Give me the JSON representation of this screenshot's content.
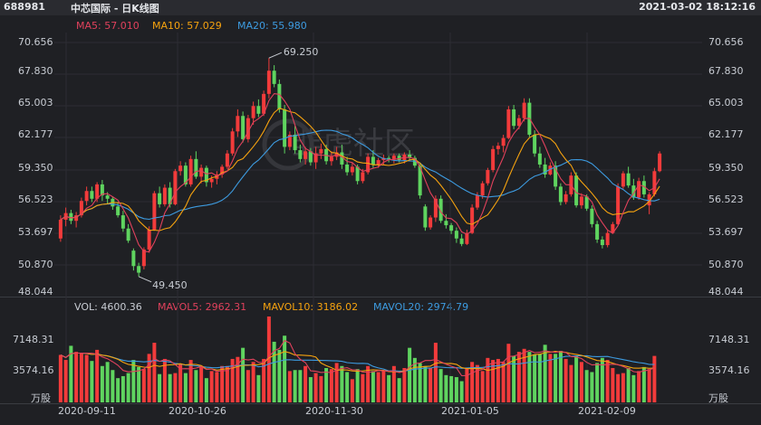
{
  "header": {
    "code": "688981",
    "title": "中芯国际 - 日K线图",
    "datetime": "2021-03-02 18:12:16"
  },
  "price_legend": [
    {
      "label": "MA5: 57.010",
      "color": "#e0415c"
    },
    {
      "label": "MA10: 57.029",
      "color": "#f5a20f"
    },
    {
      "label": "MA20: 55.980",
      "color": "#3d9be0"
    }
  ],
  "volume_legend": [
    {
      "label": "VOL: 4600.36",
      "color": "#c8ccd3"
    },
    {
      "label": "MAVOL5: 2962.31",
      "color": "#e0415c"
    },
    {
      "label": "MAVOL10: 3186.02",
      "color": "#f5a20f"
    },
    {
      "label": "MAVOL20: 2974.79",
      "color": "#3d9be0"
    }
  ],
  "price_axis": [
    "70.656",
    "67.830",
    "65.003",
    "62.177",
    "59.350",
    "56.523",
    "53.697",
    "50.870",
    "48.044"
  ],
  "volume_axis": [
    "7148.31",
    "3574.16",
    "万股"
  ],
  "date_axis": [
    "2020-09-11",
    "2020-10-26",
    "2020-11-30",
    "2021-01-05",
    "2021-02-09"
  ],
  "annotations": {
    "high": "69.250",
    "low": "49.450"
  },
  "watermark": "韭虎社区",
  "colors": {
    "up": "#f23b3b",
    "down": "#5fd45f"
  },
  "chart_data": {
    "type": "candlestick",
    "title": "中芯国际 - 日K线图",
    "ylim": [
      48.044,
      70.656
    ],
    "volume_ylim": [
      0,
      8500
    ],
    "ohlc": [
      [
        52.9,
        55.0,
        52.6,
        54.6
      ],
      [
        54.6,
        55.7,
        54.0,
        55.2
      ],
      [
        55.2,
        55.5,
        54.2,
        54.5
      ],
      [
        54.5,
        55.3,
        53.9,
        55.0
      ],
      [
        55.0,
        56.6,
        54.8,
        56.3
      ],
      [
        56.3,
        57.6,
        55.9,
        57.2
      ],
      [
        57.2,
        57.6,
        56.2,
        56.5
      ],
      [
        56.5,
        58.0,
        56.2,
        57.8
      ],
      [
        57.8,
        58.2,
        56.3,
        56.8
      ],
      [
        56.8,
        57.1,
        56.0,
        56.5
      ],
      [
        56.5,
        56.7,
        55.5,
        55.8
      ],
      [
        55.8,
        56.2,
        54.8,
        55.0
      ],
      [
        55.0,
        55.4,
        53.5,
        53.8
      ],
      [
        53.8,
        54.2,
        52.5,
        52.7
      ],
      [
        51.8,
        52.0,
        50.0,
        50.4
      ],
      [
        50.4,
        50.7,
        49.45,
        49.8
      ],
      [
        50.4,
        52.1,
        50.1,
        51.9
      ],
      [
        51.9,
        54.0,
        51.6,
        53.7
      ],
      [
        53.7,
        57.2,
        53.6,
        57.0
      ],
      [
        57.0,
        57.6,
        55.7,
        56.0
      ],
      [
        56.0,
        57.8,
        55.8,
        57.5
      ],
      [
        57.5,
        58.0,
        55.7,
        56.0
      ],
      [
        56.0,
        59.2,
        55.9,
        59.0
      ],
      [
        59.0,
        59.9,
        58.6,
        59.5
      ],
      [
        59.5,
        59.8,
        57.6,
        57.8
      ],
      [
        57.8,
        60.4,
        57.6,
        60.1
      ],
      [
        60.1,
        60.8,
        58.3,
        58.5
      ],
      [
        58.5,
        59.6,
        57.9,
        59.3
      ],
      [
        59.3,
        59.5,
        57.6,
        58.0
      ],
      [
        58.0,
        58.6,
        57.5,
        58.3
      ],
      [
        58.3,
        59.0,
        57.8,
        58.7
      ],
      [
        58.7,
        59.6,
        58.4,
        59.4
      ],
      [
        59.4,
        60.9,
        59.2,
        60.6
      ],
      [
        60.6,
        62.9,
        60.4,
        62.6
      ],
      [
        62.6,
        64.6,
        62.1,
        64.0
      ],
      [
        64.0,
        64.4,
        61.6,
        61.9
      ],
      [
        61.9,
        64.1,
        61.6,
        63.8
      ],
      [
        63.8,
        65.3,
        63.2,
        64.9
      ],
      [
        64.9,
        65.5,
        63.9,
        64.2
      ],
      [
        64.2,
        66.3,
        64.0,
        66.0
      ],
      [
        66.0,
        69.25,
        65.6,
        68.1
      ],
      [
        68.1,
        68.6,
        66.6,
        66.9
      ],
      [
        66.9,
        67.3,
        64.3,
        64.6
      ],
      [
        64.6,
        65.0,
        60.6,
        61.2
      ],
      [
        61.2,
        62.6,
        60.9,
        62.3
      ],
      [
        62.3,
        63.1,
        60.6,
        60.9
      ],
      [
        60.9,
        61.4,
        59.8,
        60.1
      ],
      [
        60.1,
        61.2,
        59.6,
        60.8
      ],
      [
        60.8,
        61.1,
        59.5,
        59.8
      ],
      [
        59.8,
        61.2,
        59.2,
        60.6
      ],
      [
        60.6,
        61.5,
        60.1,
        61.0
      ],
      [
        61.0,
        61.4,
        59.6,
        59.9
      ],
      [
        59.9,
        60.8,
        59.5,
        60.3
      ],
      [
        60.3,
        61.2,
        60.0,
        60.7
      ],
      [
        60.7,
        61.4,
        59.2,
        59.6
      ],
      [
        59.6,
        60.3,
        58.6,
        58.9
      ],
      [
        58.9,
        59.8,
        58.6,
        59.4
      ],
      [
        59.4,
        59.6,
        57.8,
        58.1
      ],
      [
        58.1,
        59.2,
        57.9,
        58.9
      ],
      [
        58.9,
        60.6,
        58.7,
        60.3
      ],
      [
        60.3,
        60.9,
        59.3,
        59.6
      ],
      [
        59.6,
        60.2,
        59.3,
        60.0
      ],
      [
        60.0,
        60.5,
        59.6,
        60.2
      ],
      [
        60.2,
        60.4,
        59.8,
        60.1
      ],
      [
        60.1,
        60.6,
        59.7,
        60.4
      ],
      [
        60.4,
        60.6,
        59.8,
        60.0
      ],
      [
        60.0,
        60.7,
        59.7,
        60.5
      ],
      [
        60.5,
        60.9,
        59.9,
        60.2
      ],
      [
        60.2,
        60.4,
        59.3,
        59.5
      ],
      [
        59.5,
        59.8,
        56.5,
        56.8
      ],
      [
        55.8,
        56.0,
        53.6,
        53.9
      ],
      [
        53.9,
        55.0,
        53.7,
        54.8
      ],
      [
        54.8,
        56.8,
        54.4,
        56.5
      ],
      [
        56.5,
        56.8,
        54.3,
        54.5
      ],
      [
        54.5,
        55.1,
        53.8,
        54.1
      ],
      [
        54.1,
        54.3,
        53.3,
        53.6
      ],
      [
        53.6,
        53.9,
        52.5,
        52.9
      ],
      [
        52.9,
        53.3,
        52.2,
        52.4
      ],
      [
        52.4,
        53.7,
        52.3,
        53.4
      ],
      [
        53.4,
        56.0,
        53.3,
        55.7
      ],
      [
        55.7,
        57.1,
        55.5,
        56.8
      ],
      [
        56.8,
        58.1,
        56.5,
        57.9
      ],
      [
        57.9,
        59.3,
        57.7,
        59.1
      ],
      [
        59.1,
        61.3,
        58.9,
        61.0
      ],
      [
        61.0,
        61.6,
        60.5,
        61.3
      ],
      [
        61.3,
        62.3,
        60.7,
        62.0
      ],
      [
        62.0,
        64.9,
        61.9,
        64.6
      ],
      [
        64.6,
        65.0,
        62.8,
        63.1
      ],
      [
        63.1,
        64.1,
        62.8,
        63.8
      ],
      [
        63.8,
        65.6,
        63.5,
        65.2
      ],
      [
        65.2,
        65.6,
        62.1,
        62.3
      ],
      [
        62.3,
        62.7,
        60.3,
        60.6
      ],
      [
        60.6,
        61.2,
        59.3,
        59.6
      ],
      [
        59.6,
        60.2,
        58.4,
        58.7
      ],
      [
        58.7,
        59.8,
        58.6,
        59.5
      ],
      [
        59.5,
        59.9,
        57.3,
        57.6
      ],
      [
        57.6,
        57.9,
        55.9,
        56.2
      ],
      [
        56.2,
        57.2,
        56.0,
        56.9
      ],
      [
        56.9,
        58.9,
        56.7,
        58.6
      ],
      [
        58.6,
        58.9,
        55.7,
        55.9
      ],
      [
        55.9,
        57.0,
        55.6,
        56.7
      ],
      [
        56.7,
        56.9,
        55.4,
        55.6
      ],
      [
        55.6,
        55.9,
        53.9,
        54.2
      ],
      [
        54.2,
        54.5,
        52.5,
        52.8
      ],
      [
        52.8,
        53.1,
        52.0,
        52.3
      ],
      [
        52.3,
        53.6,
        52.1,
        53.4
      ],
      [
        53.4,
        54.4,
        53.3,
        54.2
      ],
      [
        54.2,
        57.9,
        54.1,
        57.6
      ],
      [
        57.6,
        59.0,
        57.4,
        58.8
      ],
      [
        58.8,
        59.4,
        57.5,
        57.7
      ],
      [
        57.7,
        58.3,
        56.4,
        56.6
      ],
      [
        56.6,
        58.4,
        56.4,
        58.1
      ],
      [
        58.1,
        58.6,
        56.6,
        56.9
      ],
      [
        55.9,
        57.1,
        55.1,
        56.9
      ],
      [
        56.9,
        59.3,
        56.7,
        59.0
      ],
      [
        59.0,
        60.8,
        58.9,
        60.6
      ]
    ],
    "volume": [
      4700,
      4200,
      5600,
      5000,
      4900,
      4700,
      4100,
      5200,
      3600,
      4000,
      3200,
      2400,
      2600,
      2900,
      4200,
      3500,
      3300,
      4800,
      5900,
      2800,
      4300,
      2800,
      2900,
      3800,
      2900,
      4200,
      3200,
      3600,
      2400,
      3100,
      3000,
      3600,
      3600,
      4300,
      4500,
      5400,
      3200,
      4000,
      2700,
      4300,
      8500,
      6000,
      5200,
      6600,
      3100,
      3200,
      3200,
      3600,
      2500,
      2900,
      2600,
      3400,
      3300,
      3900,
      3600,
      3000,
      2300,
      3300,
      2800,
      3600,
      3100,
      3000,
      3100,
      2700,
      3600,
      2400,
      3400,
      5400,
      4400,
      3900,
      3600,
      3400,
      5900,
      3300,
      2700,
      2600,
      2500,
      2100,
      3400,
      4000,
      3700,
      3100,
      4400,
      4200,
      4300,
      4000,
      5800,
      4600,
      5000,
      5300,
      5000,
      4700,
      4800,
      5700,
      4800,
      4800,
      5100,
      4300,
      3700,
      4600,
      4000,
      3200,
      3000,
      3900,
      4400,
      4200,
      3400,
      2800,
      2900,
      3400,
      2700,
      3100,
      3500,
      3300,
      4600
    ]
  }
}
